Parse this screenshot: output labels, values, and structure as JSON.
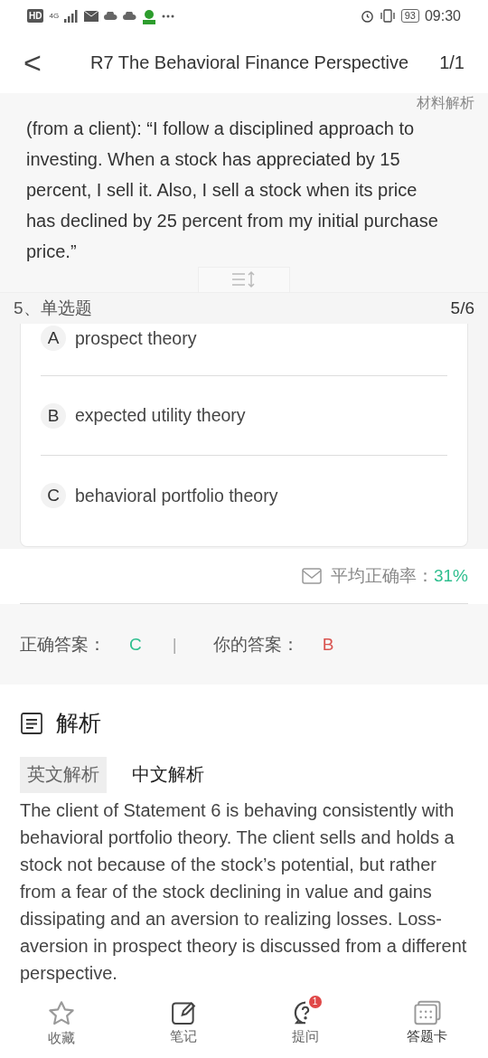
{
  "status_bar": {
    "badge": "HD",
    "network": "4G",
    "battery": "93",
    "time": "09:30"
  },
  "header": {
    "back": "<",
    "title": "R7 The Behavioral Finance Perspective",
    "page": "1/1"
  },
  "material": {
    "text": "(from a client): “I follow a disciplined approach to investing. When a stock has appreciated by 15 percent, I sell it. Also, I sell a stock when its price has declined by 25 percent from my initial purchase price.”",
    "floating_button": "材料解析"
  },
  "question": {
    "label": "5、单选题",
    "progress": "5/6"
  },
  "options": [
    {
      "letter": "A",
      "text": "prospect theory"
    },
    {
      "letter": "B",
      "text": "expected utility theory"
    },
    {
      "letter": "C",
      "text": "behavioral portfolio theory"
    }
  ],
  "accuracy": {
    "label": "平均正确率：",
    "value": "31%"
  },
  "answers": {
    "correct_label": "正确答案：",
    "correct": "C",
    "separator": "|",
    "yours_label": "你的答案：",
    "yours": "B"
  },
  "analysis": {
    "title": "解析",
    "tabs": [
      {
        "label": "英文解析",
        "selected": true
      },
      {
        "label": "中文解析",
        "selected": false
      }
    ],
    "text": "The client of Statement 6 is behaving consistently with behavioral portfolio theory. The client sells and holds a stock not because of the stock’s potential, but rather from a fear of the stock declining in value and gains dissipating and an aversion to realizing losses. Loss-aversion in prospect theory is discussed from a different perspective."
  },
  "bottom_nav": [
    {
      "kind": "star",
      "label": "收藏"
    },
    {
      "kind": "note",
      "label": "笔记"
    },
    {
      "kind": "ask",
      "label": "提问",
      "badge": "1"
    },
    {
      "kind": "card",
      "label": "答题卡"
    }
  ]
}
